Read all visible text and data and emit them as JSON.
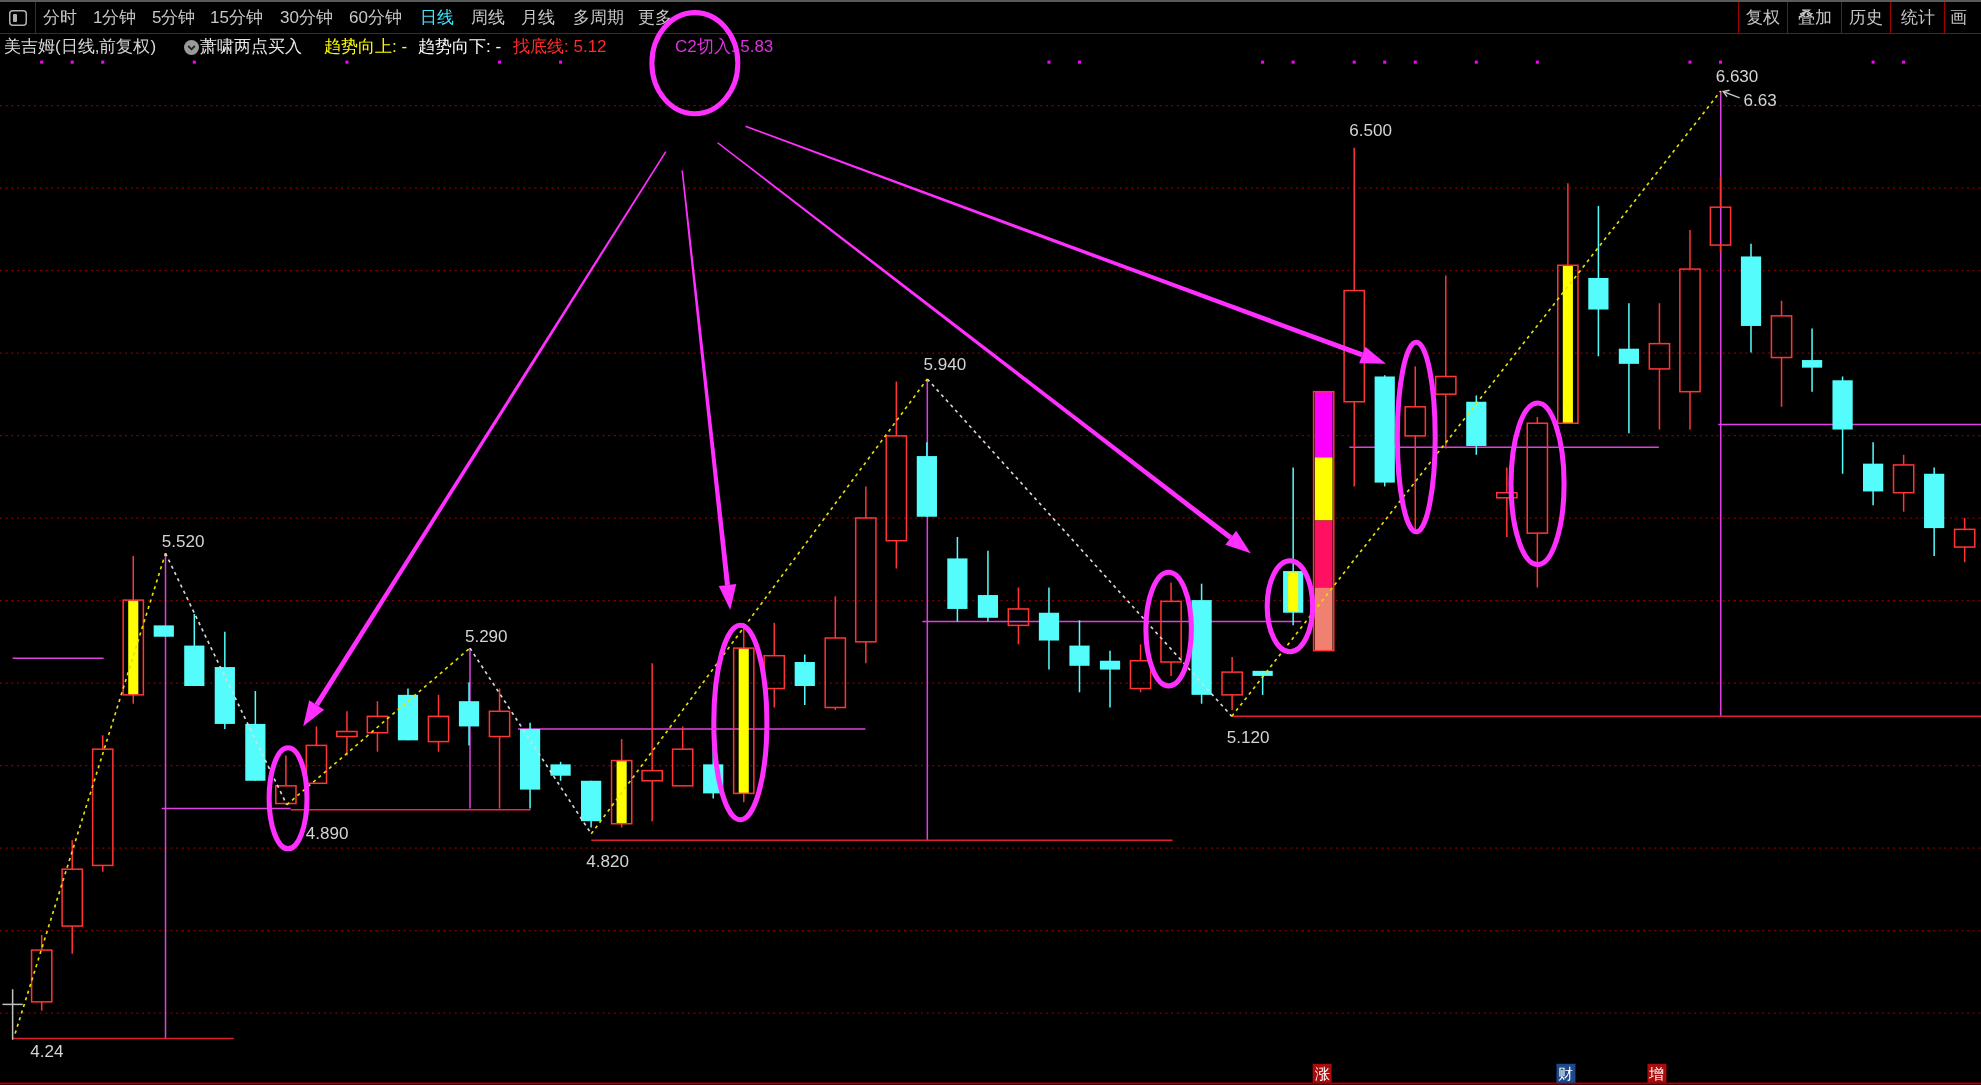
{
  "toolbar": {
    "periods": [
      {
        "label": "分时",
        "selected": false
      },
      {
        "label": "1分钟",
        "selected": false
      },
      {
        "label": "5分钟",
        "selected": false
      },
      {
        "label": "15分钟",
        "selected": false
      },
      {
        "label": "30分钟",
        "selected": false
      },
      {
        "label": "60分钟",
        "selected": false
      },
      {
        "label": "日线",
        "selected": true
      },
      {
        "label": "周线",
        "selected": false
      },
      {
        "label": "月线",
        "selected": false
      },
      {
        "label": "多周期",
        "selected": false
      },
      {
        "label": "更多",
        "selected": false
      }
    ],
    "tools": [
      "复权",
      "叠加",
      "历史",
      "统计",
      "画"
    ]
  },
  "legend": {
    "title": "美吉姆(日线,前复权)",
    "indicator": "萧啸两点买入",
    "values": [
      {
        "label": "趋势向上:",
        "value": "-",
        "color": "#ffff00"
      },
      {
        "label": "趋势向下:",
        "value": "-",
        "color": "#ffffff"
      },
      {
        "label": "找底线:",
        "value": "5.12",
        "color": "#ff2a2a"
      },
      {
        "label": "C2切入:",
        "value": "5.83",
        "color": "#e030e0"
      }
    ]
  },
  "chart": {
    "price_labels": [
      "5.520",
      "4.890",
      "5.290",
      "4.820",
      "5.940",
      "5.120",
      "6.500",
      "6.630",
      "6.63",
      "4.24"
    ]
  },
  "event_markers": [
    {
      "label": "涨",
      "color": "#a80c0c"
    },
    {
      "label": "财",
      "color": "#1c4a8c"
    },
    {
      "label": "增",
      "color": "#a80c0c"
    }
  ]
}
